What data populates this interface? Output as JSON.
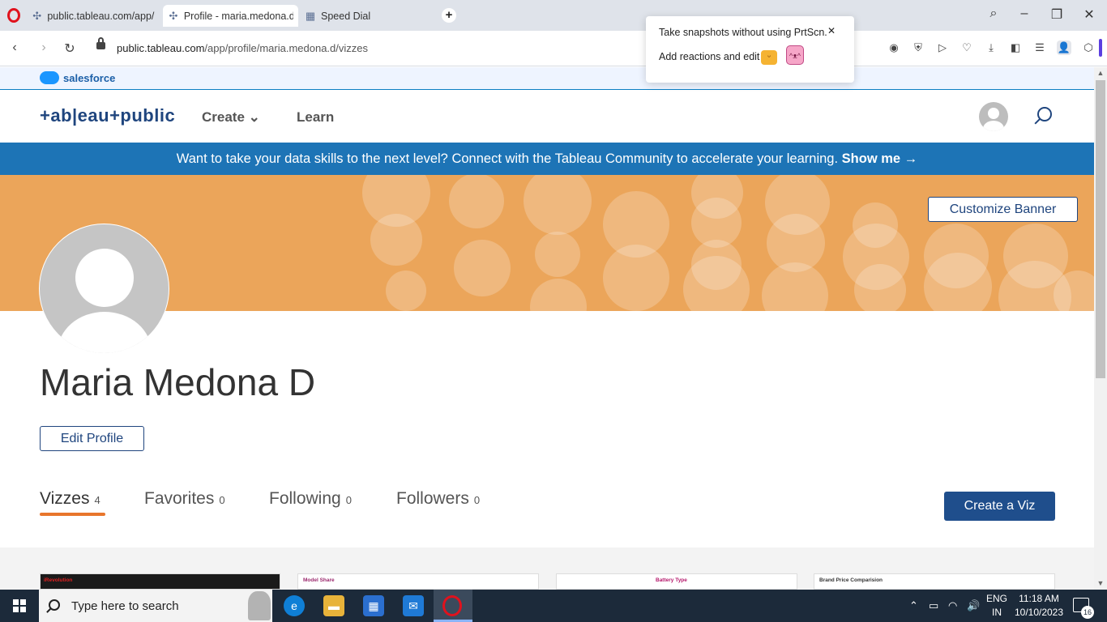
{
  "browser": {
    "tabs": [
      {
        "label": "public.tableau.com/app/p"
      },
      {
        "label": "Profile - maria.medona.d"
      },
      {
        "label": "Speed Dial"
      }
    ],
    "url_host": "public.tableau.com",
    "url_path": "/app/profile/maria.medona.d/vizzes"
  },
  "popup": {
    "line1": "Take snapshots without using PrtScn.",
    "line2": "Add reactions and edit"
  },
  "salesforce": {
    "label": "salesforce"
  },
  "header": {
    "logo": "+ab|eau+public",
    "nav_create": "Create",
    "nav_learn": "Learn"
  },
  "promo": {
    "text": "Want to take your data skills to the next level? Connect with the Tableau Community to accelerate your learning.",
    "cta": "Show me →"
  },
  "banner": {
    "customize_label": "Customize Banner"
  },
  "profile": {
    "name": "Maria Medona D",
    "edit_label": "Edit Profile"
  },
  "tabs": [
    {
      "label": "Vizzes",
      "count": "4"
    },
    {
      "label": "Favorites",
      "count": "0"
    },
    {
      "label": "Following",
      "count": "0"
    },
    {
      "label": "Followers",
      "count": "0"
    }
  ],
  "create_viz_label": "Create a Viz",
  "thumbnails": [
    {
      "title": "iRevolution"
    },
    {
      "title": "Model Share"
    },
    {
      "title": "Battery Type"
    },
    {
      "title": "Brand Price Comparision"
    }
  ],
  "taskbar": {
    "search_placeholder": "Type here to search",
    "lang": "ENG",
    "region": "IN",
    "time": "11:18 AM",
    "date": "10/10/2023",
    "notif_count": "16"
  }
}
